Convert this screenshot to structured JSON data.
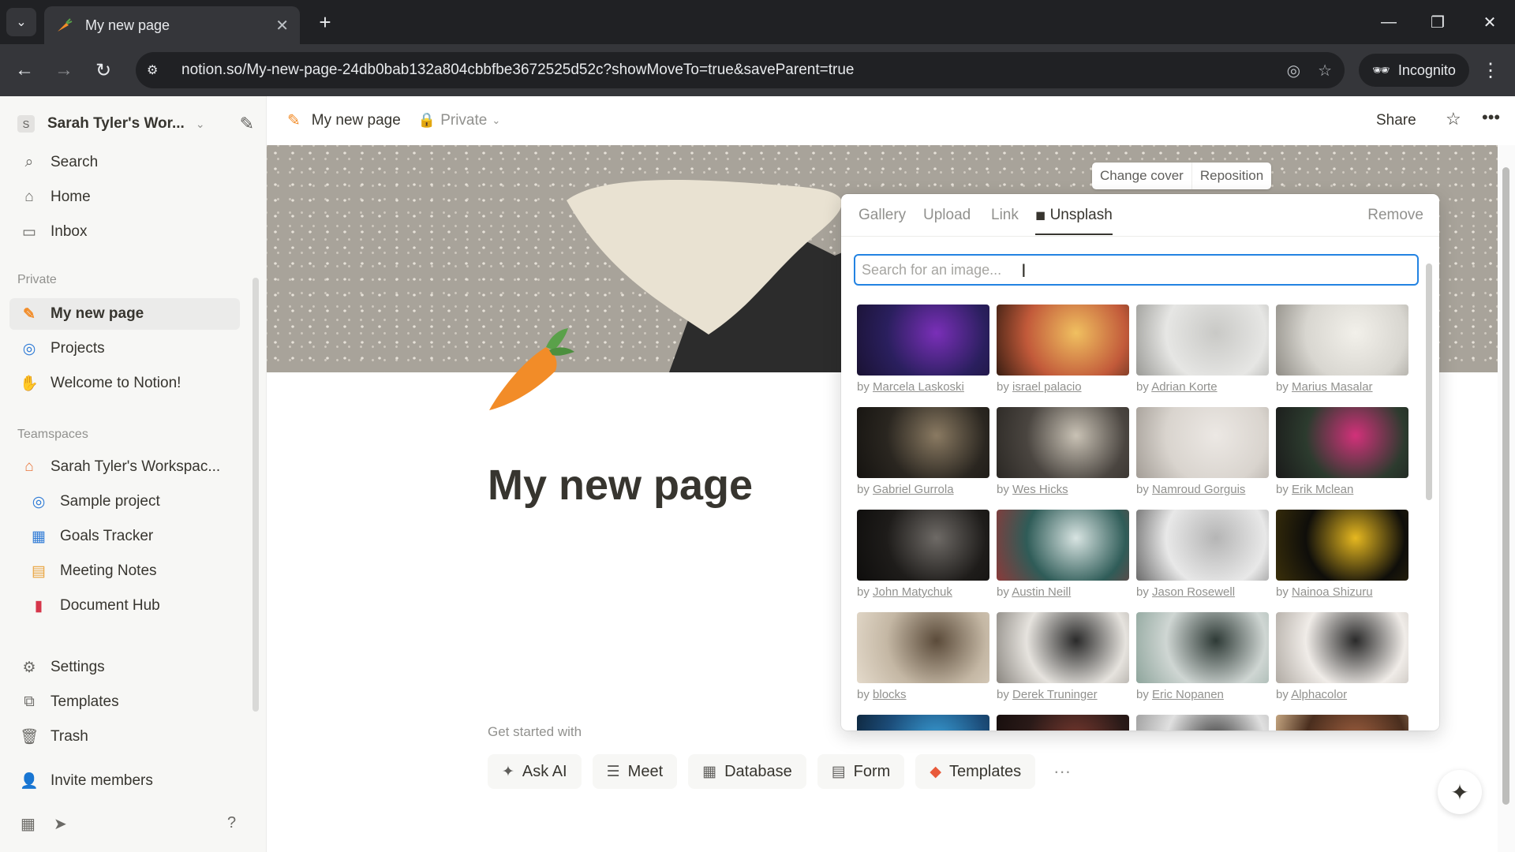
{
  "browser": {
    "tab_title": "My new page",
    "url": "notion.so/My-new-page-24db0bab132a804cbbfbe3672525d52c?showMoveTo=true&saveParent=true",
    "incognito_label": "Incognito"
  },
  "sidebar": {
    "workspace_name": "Sarah Tyler's Wor...",
    "workspace_initial": "S",
    "top_items": [
      {
        "label": "Search",
        "icon": "search-icon"
      },
      {
        "label": "Home",
        "icon": "home-icon"
      },
      {
        "label": "Inbox",
        "icon": "inbox-icon"
      }
    ],
    "private_heading": "Private",
    "private_items": [
      {
        "label": "My new page",
        "icon": "carrot-icon",
        "selected": true
      },
      {
        "label": "Projects",
        "icon": "projects-icon"
      },
      {
        "label": "Welcome to Notion!",
        "icon": "wave-icon"
      }
    ],
    "teamspaces_heading": "Teamspaces",
    "teamspace_name": "Sarah Tyler's Workspac...",
    "teamspace_items": [
      {
        "label": "Sample project",
        "icon": "target-icon"
      },
      {
        "label": "Goals Tracker",
        "icon": "chart-icon"
      },
      {
        "label": "Meeting Notes",
        "icon": "calendar-icon"
      },
      {
        "label": "Document Hub",
        "icon": "document-icon"
      }
    ],
    "bottom_items": [
      {
        "label": "Settings",
        "icon": "gear-icon"
      },
      {
        "label": "Templates",
        "icon": "templates-icon"
      },
      {
        "label": "Trash",
        "icon": "trash-icon"
      },
      {
        "label": "Invite members",
        "icon": "invite-icon"
      }
    ]
  },
  "topbar": {
    "page_title": "My new page",
    "privacy": "Private",
    "share_label": "Share"
  },
  "cover": {
    "change_cover_label": "Change cover",
    "reposition_label": "Reposition"
  },
  "popover": {
    "tabs": [
      "Gallery",
      "Upload",
      "Link",
      "Unsplash"
    ],
    "active_tab": "Unsplash",
    "remove_label": "Remove",
    "search_placeholder": "Search for an image...",
    "by_prefix": "by",
    "images": [
      {
        "author": "Marcela Laskoski",
        "colors": [
          "#2a1f5e",
          "#7a2fb8",
          "#1a1233"
        ]
      },
      {
        "author": "israel palacio",
        "colors": [
          "#c25a3a",
          "#f0c060",
          "#3a1e12"
        ]
      },
      {
        "author": "Adrian Korte",
        "colors": [
          "#e6e6e4",
          "#c9c9c6",
          "#9a9a96"
        ]
      },
      {
        "author": "Marius Masalar",
        "colors": [
          "#d8d6d0",
          "#f2f0ea",
          "#8f8c85"
        ]
      },
      {
        "author": "Gabriel Gurrola",
        "colors": [
          "#2a2620",
          "#8a7a62",
          "#151310"
        ]
      },
      {
        "author": "Wes Hicks",
        "colors": [
          "#4a4540",
          "#c9c2b5",
          "#2b2824"
        ]
      },
      {
        "author": "Namroud Gorguis",
        "colors": [
          "#d9d4ce",
          "#ece8e4",
          "#a39d96"
        ]
      },
      {
        "author": "Erik Mclean",
        "colors": [
          "#2c3b2e",
          "#d2317a",
          "#1a1a1a"
        ]
      },
      {
        "author": "John Matychuk",
        "colors": [
          "#1e1c1a",
          "#6e6a66",
          "#0e0d0c"
        ]
      },
      {
        "author": "Austin Neill",
        "colors": [
          "#2f5c58",
          "#d8e4e2",
          "#8b3a3a"
        ]
      },
      {
        "author": "Jason Rosewell",
        "colors": [
          "#e8e8e8",
          "#b5b5b5",
          "#6a6a6a"
        ]
      },
      {
        "author": "Nainoa Shizuru",
        "colors": [
          "#0f0e0a",
          "#e6b820",
          "#3a2f0a"
        ]
      },
      {
        "author": "blocks",
        "colors": [
          "#c4b7a4",
          "#5b4b3a",
          "#e4dacb"
        ]
      },
      {
        "author": "Derek Truninger",
        "colors": [
          "#e6e3de",
          "#2a2a2a",
          "#8a8680"
        ]
      },
      {
        "author": "Eric Nopanen",
        "colors": [
          "#cfd6d3",
          "#2e3a36",
          "#8ea59c"
        ]
      },
      {
        "author": "Alphacolor",
        "colors": [
          "#f0ece8",
          "#2a2a2a",
          "#b0aaa3"
        ]
      },
      {
        "author": "",
        "colors": [
          "#1c4d7a",
          "#3aa0d8",
          "#0d2338"
        ]
      },
      {
        "author": "",
        "colors": [
          "#2a1a18",
          "#7a3a30",
          "#150d0c"
        ]
      },
      {
        "author": "",
        "colors": [
          "#e0e0e0",
          "#3a3a3a",
          "#999999"
        ]
      },
      {
        "author": "",
        "colors": [
          "#4a2e1e",
          "#a06040",
          "#d8b890"
        ]
      }
    ]
  },
  "page": {
    "title": "My new page",
    "get_started_label": "Get started with",
    "get_started_buttons": [
      {
        "label": "Ask AI",
        "icon": "ai-icon"
      },
      {
        "label": "Meet",
        "icon": "meet-icon"
      },
      {
        "label": "Database",
        "icon": "table-icon"
      },
      {
        "label": "Form",
        "icon": "form-icon"
      },
      {
        "label": "Templates",
        "icon": "templates-icon"
      }
    ]
  }
}
